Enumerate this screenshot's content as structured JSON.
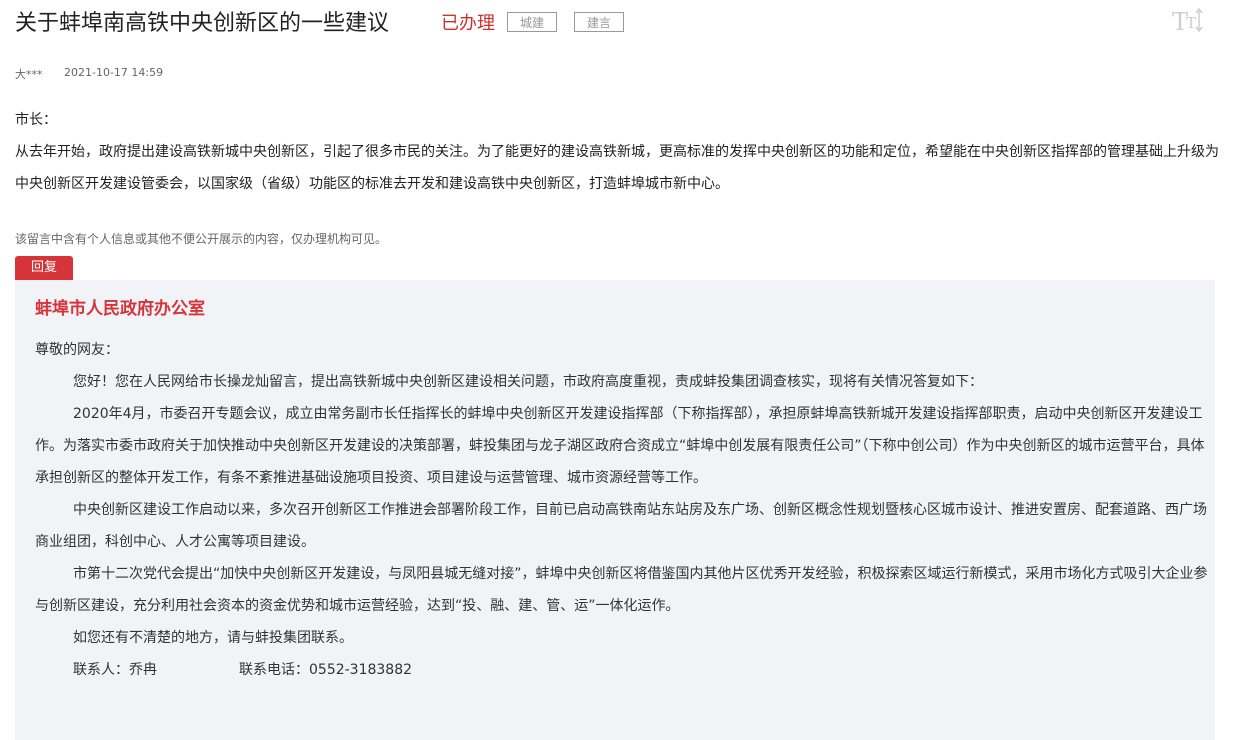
{
  "header": {
    "title": "关于蚌埠南高铁中央创新区的一些建议",
    "status": "已办理",
    "tags": [
      "城建",
      "建言"
    ]
  },
  "meta": {
    "author": "大***",
    "date": "2021-10-17 14:59"
  },
  "message": {
    "salutation": "市长：",
    "body": "从去年开始，政府提出建设高铁新城中央创新区，引起了很多市民的关注。为了能更好的建设高铁新城，更高标准的发挥中央创新区的功能和定位，希望能在中央创新区指挥部的管理基础上升级为中央创新区开发建设管委会，以国家级（省级）功能区的标准去开发和建设高铁中央创新区，打造蚌埠城市新中心。",
    "privacy_note": "该留言中含有个人信息或其他不便公开展示的内容，仅办理机构可见。"
  },
  "reply": {
    "tab_label": "回复",
    "org": "蚌埠市人民政府办公室",
    "greeting": "尊敬的网友：",
    "paragraphs": [
      "您好！您在人民网给市长操龙灿留言，提出高铁新城中央创新区建设相关问题，市政府高度重视，责成蚌投集团调查核实，现将有关情况答复如下：",
      "2020年4月，市委召开专题会议，成立由常务副市长任指挥长的蚌埠中央创新区开发建设指挥部（下称指挥部），承担原蚌埠高铁新城开发建设指挥部职责，启动中央创新区开发建设工作。为落实市委市政府关于加快推动中央创新区开发建设的决策部署，蚌投集团与龙子湖区政府合资成立“蚌埠中创发展有限责任公司”（下称中创公司）作为中央创新区的城市运营平台，具体承担创新区的整体开发工作，有条不紊推进基础设施项目投资、项目建设与运营管理、城市资源经营等工作。",
      "中央创新区建设工作启动以来，多次召开创新区工作推进会部署阶段工作，目前已启动高铁南站东站房及东广场、创新区概念性规划暨核心区城市设计、推进安置房、配套道路、西广场商业组团，科创中心、人才公寓等项目建设。",
      "市第十二次党代会提出“加快中央创新区开发建设，与凤阳县城无缝对接”，蚌埠中央创新区将借鉴国内其他片区优秀开发经验，积极探索区域运行新模式，采用市场化方式吸引大企业参与创新区建设，充分利用社会资本的资金优势和城市运营经验，达到“投、融、建、管、运”一体化运作。",
      "如您还有不清楚的地方，请与蚌投集团联系。"
    ],
    "contact_person": "联系人：乔冉",
    "contact_phone": "联系电话：0552-3183882"
  },
  "colors": {
    "accent": "#d4343a",
    "reply_bg": "#f2f3f7"
  },
  "icons": {
    "font_size": "font-size-icon"
  }
}
